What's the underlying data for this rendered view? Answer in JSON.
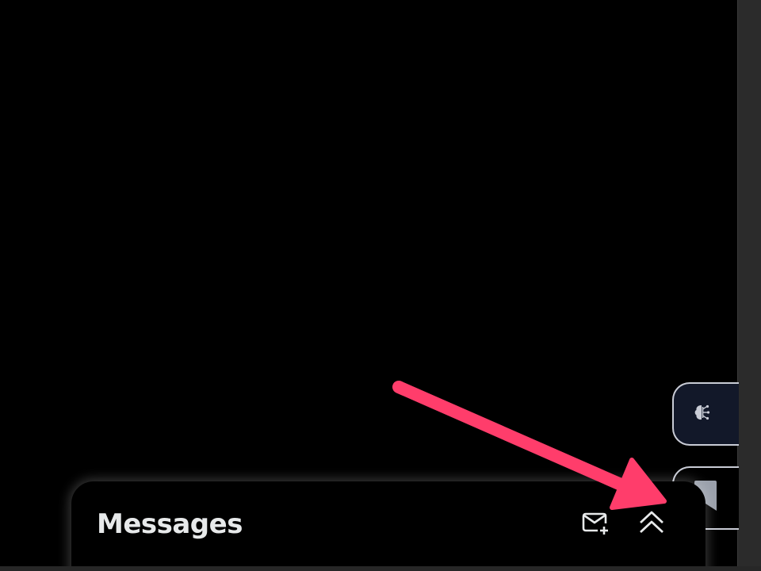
{
  "messages_drawer": {
    "title": "Messages",
    "new_message_icon": "envelope-plus-icon",
    "collapse_icon": "double-chevron-up-icon"
  },
  "side_tabs": {
    "ai_icon": "brain-circuit-icon",
    "bookmark_icon": "bookmark-icon"
  },
  "annotation": {
    "arrow_color": "#ff3d6b"
  },
  "colors": {
    "background": "#000000",
    "text": "#e7e9ea",
    "tab_border": "#c9ccd6",
    "ai_tab_bg": "#121829",
    "bookmark_fill": "#9aa0ab"
  }
}
